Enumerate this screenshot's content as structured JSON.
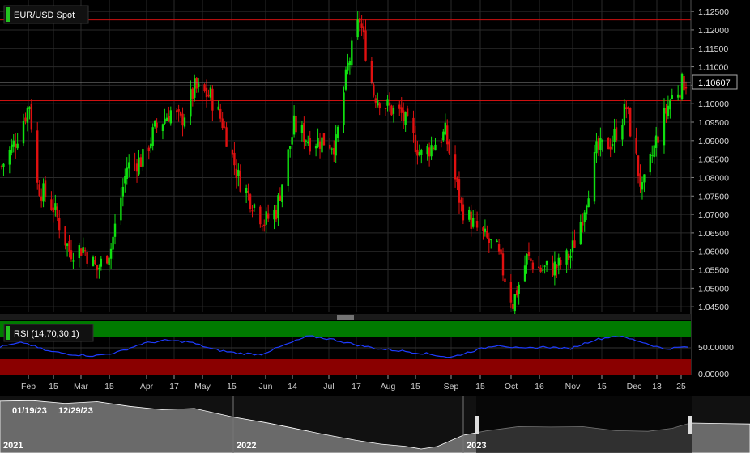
{
  "instrument": {
    "label": "EUR/USD Spot",
    "accent": "#23c21f"
  },
  "price_pane": {
    "y_ticks": [
      "1.12500",
      "1.12000",
      "1.11500",
      "1.11000",
      "1.10500",
      "1.10000",
      "1.09500",
      "1.09000",
      "1.08500",
      "1.08000",
      "1.07500",
      "1.07000",
      "1.06500",
      "1.06000",
      "1.05500",
      "1.05000",
      "1.04500"
    ],
    "last_price_label": "1.10607",
    "levels": [
      1.1227,
      1.1008
    ]
  },
  "rsi_pane": {
    "label": "RSI (14,70,30,1)",
    "y_ticks": [
      "50.00000",
      "0.00000"
    ],
    "overbought_color": "#007a00",
    "oversold_color": "#8a0000"
  },
  "x_axis": {
    "ticks": [
      "Feb",
      "15",
      "Mar",
      "15",
      "Apr",
      "17",
      "May",
      "15",
      "Jun",
      "14",
      "Jul",
      "17",
      "Aug",
      "15",
      "Sep",
      "15",
      "Oct",
      "16",
      "Nov",
      "15",
      "Dec",
      "13",
      "25"
    ]
  },
  "navigator": {
    "range_start": "01/19/23",
    "range_end": "12/29/23",
    "years": [
      "2021",
      "2022",
      "2023"
    ]
  },
  "colors": {
    "up": "#10e010",
    "down": "#e01010",
    "rsi_line": "#1e3cff",
    "level_line": "#cc1010",
    "grid": "#2a2a2a"
  },
  "chart_data": {
    "type": "candlestick",
    "title": "EUR/USD Spot",
    "x_range": [
      "2023-01-19",
      "2023-12-29"
    ],
    "ylim": [
      1.0435,
      1.127
    ],
    "last": 1.10607,
    "horizontal_levels": [
      1.1227,
      1.1008
    ],
    "series": [
      {
        "name": "EUR/USD Spot",
        "close_path": [
          [
            "2023-01-19",
            1.083
          ],
          [
            "2023-01-26",
            1.09
          ],
          [
            "2023-02-02",
            1.1
          ],
          [
            "2023-02-06",
            1.078
          ],
          [
            "2023-02-14",
            1.072
          ],
          [
            "2023-02-22",
            1.06
          ],
          [
            "2023-03-01",
            1.061
          ],
          [
            "2023-03-08",
            1.055
          ],
          [
            "2023-03-15",
            1.061
          ],
          [
            "2023-03-23",
            1.083
          ],
          [
            "2023-03-31",
            1.085
          ],
          [
            "2023-04-06",
            1.093
          ],
          [
            "2023-04-14",
            1.098
          ],
          [
            "2023-04-19",
            1.095
          ],
          [
            "2023-04-26",
            1.104
          ],
          [
            "2023-05-04",
            1.102
          ],
          [
            "2023-05-10",
            1.095
          ],
          [
            "2023-05-18",
            1.08
          ],
          [
            "2023-05-31",
            1.068
          ],
          [
            "2023-06-06",
            1.071
          ],
          [
            "2023-06-15",
            1.094
          ],
          [
            "2023-06-23",
            1.09
          ],
          [
            "2023-06-30",
            1.09
          ],
          [
            "2023-07-06",
            1.089
          ],
          [
            "2023-07-12",
            1.11
          ],
          [
            "2023-07-18",
            1.123
          ],
          [
            "2023-07-25",
            1.103
          ],
          [
            "2023-08-01",
            1.099
          ],
          [
            "2023-08-08",
            1.097
          ],
          [
            "2023-08-18",
            1.086
          ],
          [
            "2023-08-30",
            1.092
          ],
          [
            "2023-09-07",
            1.072
          ],
          [
            "2023-09-15",
            1.066
          ],
          [
            "2023-09-25",
            1.06
          ],
          [
            "2023-10-03",
            1.046
          ],
          [
            "2023-10-10",
            1.058
          ],
          [
            "2023-10-17",
            1.055
          ],
          [
            "2023-10-26",
            1.056
          ],
          [
            "2023-11-01",
            1.059
          ],
          [
            "2023-11-07",
            1.07
          ],
          [
            "2023-11-14",
            1.087
          ],
          [
            "2023-11-22",
            1.09
          ],
          [
            "2023-11-29",
            1.099
          ],
          [
            "2023-12-07",
            1.076
          ],
          [
            "2023-12-14",
            1.09
          ],
          [
            "2023-12-21",
            1.101
          ],
          [
            "2023-12-28",
            1.106
          ]
        ]
      },
      {
        "name": "RSI (14,70,30,1)",
        "values": [
          52,
          60,
          44,
          38,
          35,
          42,
          58,
          64,
          61,
          47,
          40,
          38,
          55,
          72,
          66,
          56,
          48,
          44,
          39,
          32,
          45,
          56,
          48,
          52,
          48,
          64,
          73,
          62,
          48,
          52
        ]
      }
    ]
  }
}
